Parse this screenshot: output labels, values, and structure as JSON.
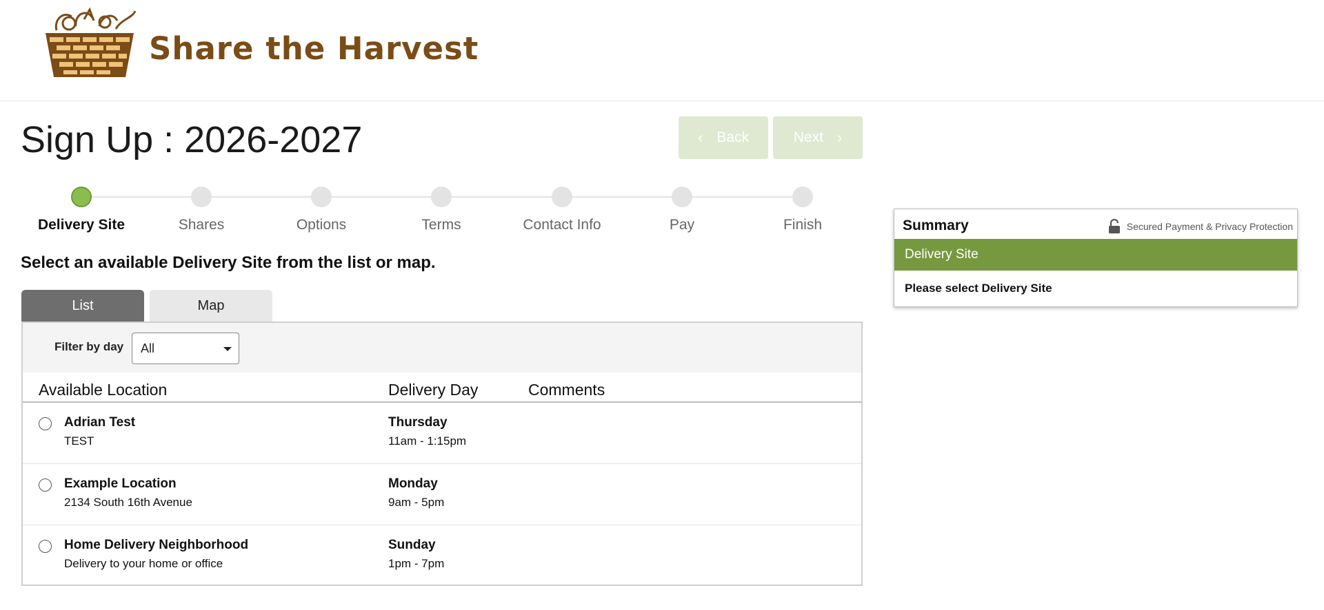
{
  "brand": {
    "logo_text": "Share the Harvest"
  },
  "page": {
    "title": "Sign Up : 2026-2027"
  },
  "navigation": {
    "back_label": "Back",
    "next_label": "Next"
  },
  "steps": [
    {
      "label": "Delivery Site",
      "active": true
    },
    {
      "label": "Shares",
      "active": false
    },
    {
      "label": "Options",
      "active": false
    },
    {
      "label": "Terms",
      "active": false
    },
    {
      "label": "Contact Info",
      "active": false
    },
    {
      "label": "Pay",
      "active": false
    },
    {
      "label": "Finish",
      "active": false
    }
  ],
  "instruction": "Select an available Delivery Site from the list or map.",
  "tabs": {
    "list_label": "List",
    "map_label": "Map",
    "selected": "List"
  },
  "filter": {
    "label": "Filter by day",
    "value": "All"
  },
  "table": {
    "headers": {
      "location": "Available Location",
      "day": "Delivery Day",
      "comments": "Comments"
    },
    "rows": [
      {
        "name": "Adrian Test",
        "description": "TEST",
        "day": "Thursday",
        "time": "11am - 1:15pm",
        "comments": ""
      },
      {
        "name": "Example Location",
        "description": "2134 South 16th Avenue",
        "day": "Monday",
        "time": "9am - 5pm",
        "comments": ""
      },
      {
        "name": "Home Delivery Neighborhood",
        "description": "Delivery to your home or office",
        "day": "Sunday",
        "time": "1pm - 7pm",
        "comments": ""
      }
    ]
  },
  "summary": {
    "title": "Summary",
    "secure_text": "Secured Payment & Privacy Protection",
    "section_label": "Delivery Site",
    "message": "Please select Delivery Site"
  },
  "colors": {
    "brand_brown": "#7a4c16",
    "accent_green": "#76993f",
    "step_active": "#8bbd4e",
    "nav_button_disabled": "#dfe9d2",
    "tab_active": "#6e6e6e"
  },
  "icons": {
    "logo": "harvest-basket-icon",
    "back": "chevron-left-icon",
    "next": "chevron-right-icon",
    "lock": "lock-icon",
    "select": "caret-down-icon"
  }
}
